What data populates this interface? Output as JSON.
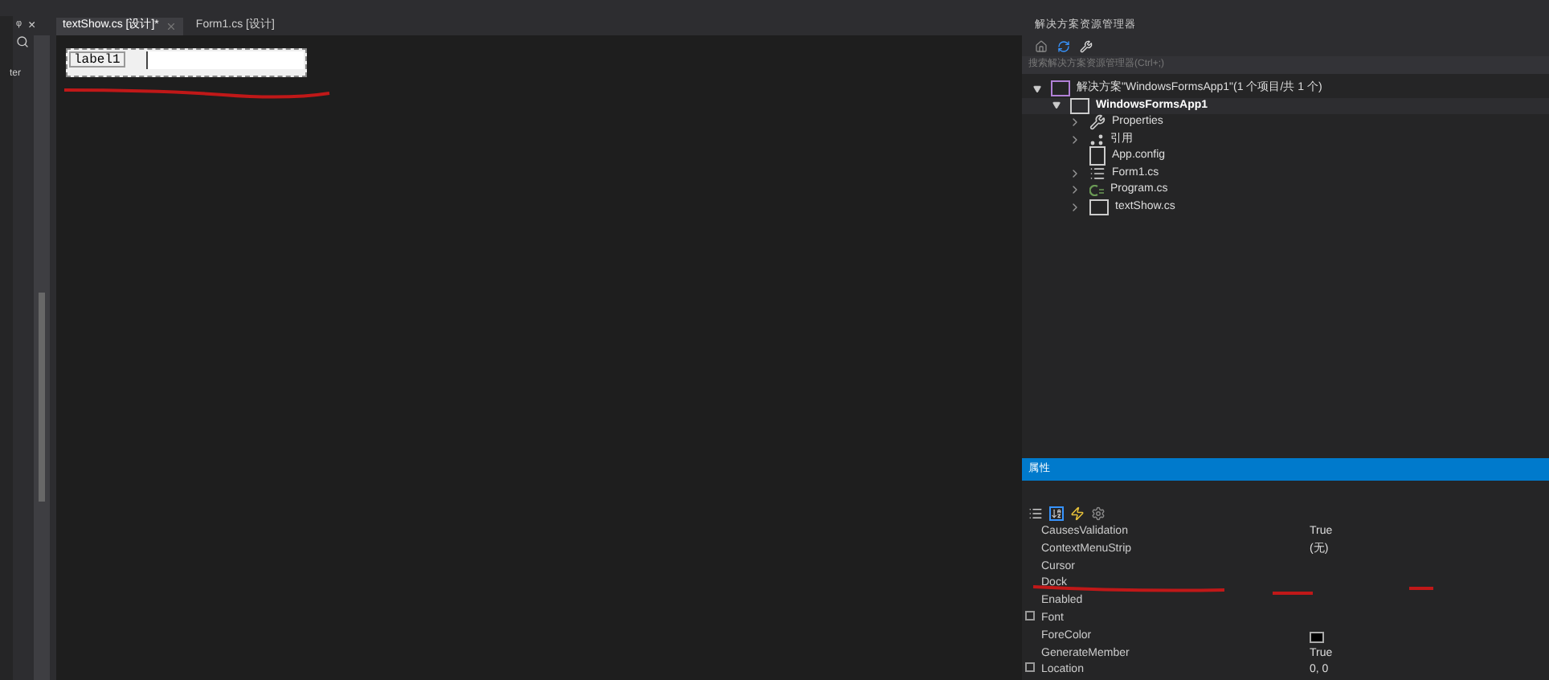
{
  "toolbox": {
    "pin": "ᵠ",
    "close": "×",
    "fragment": "ter"
  },
  "tabs": [
    {
      "label": "textShow.cs [设计]*",
      "selected": true
    },
    {
      "label": "Form1.cs [设计]",
      "selected": false
    }
  ],
  "designer": {
    "label": "label1"
  },
  "solution_explorer": {
    "title": "解决方案资源管理器",
    "search": {
      "placeholder": "搜索解决方案资源管理器(Ctrl+;)"
    },
    "tree": [
      {
        "label": "解决方案\"WindowsFormsApp1\"(1 个项目/共 1 个)",
        "kind": "solution",
        "expanded": true,
        "children": [
          {
            "label": "WindowsFormsApp1",
            "kind": "project",
            "expanded": true,
            "children": [
              {
                "label": "Properties",
                "kind": "wrench",
                "expanded": false
              },
              {
                "label": "引用",
                "kind": "refs",
                "expanded": false
              },
              {
                "label": "App.config",
                "kind": "config"
              },
              {
                "label": "Form1.cs",
                "kind": "form",
                "expanded": false
              },
              {
                "label": "Program.cs",
                "kind": "cs",
                "expanded": false
              },
              {
                "label": "textShow.cs",
                "kind": "control",
                "expanded": false
              }
            ]
          }
        ]
      }
    ]
  },
  "properties": {
    "title": "属性",
    "rows": [
      {
        "name": "CausesValidation",
        "value": "True",
        "kind": "text",
        "expandable": false
      },
      {
        "name": "ContextMenuStrip",
        "value": "(无)",
        "kind": "text",
        "expandable": false
      },
      {
        "name": "Cursor",
        "kind": "text",
        "expandable": false
      },
      {
        "name": "Dock",
        "kind": "text",
        "expandable": false
      },
      {
        "name": "Enabled",
        "kind": "text",
        "expandable": false
      },
      {
        "name": "Font",
        "kind": "text",
        "expandable": true
      },
      {
        "name": "ForeColor",
        "kind": "color",
        "expandable": false
      },
      {
        "name": "GenerateMember",
        "value": "True",
        "kind": "text",
        "expandable": false
      },
      {
        "name": "Location",
        "value": "0, 0",
        "kind": "text",
        "expandable": true
      }
    ]
  }
}
